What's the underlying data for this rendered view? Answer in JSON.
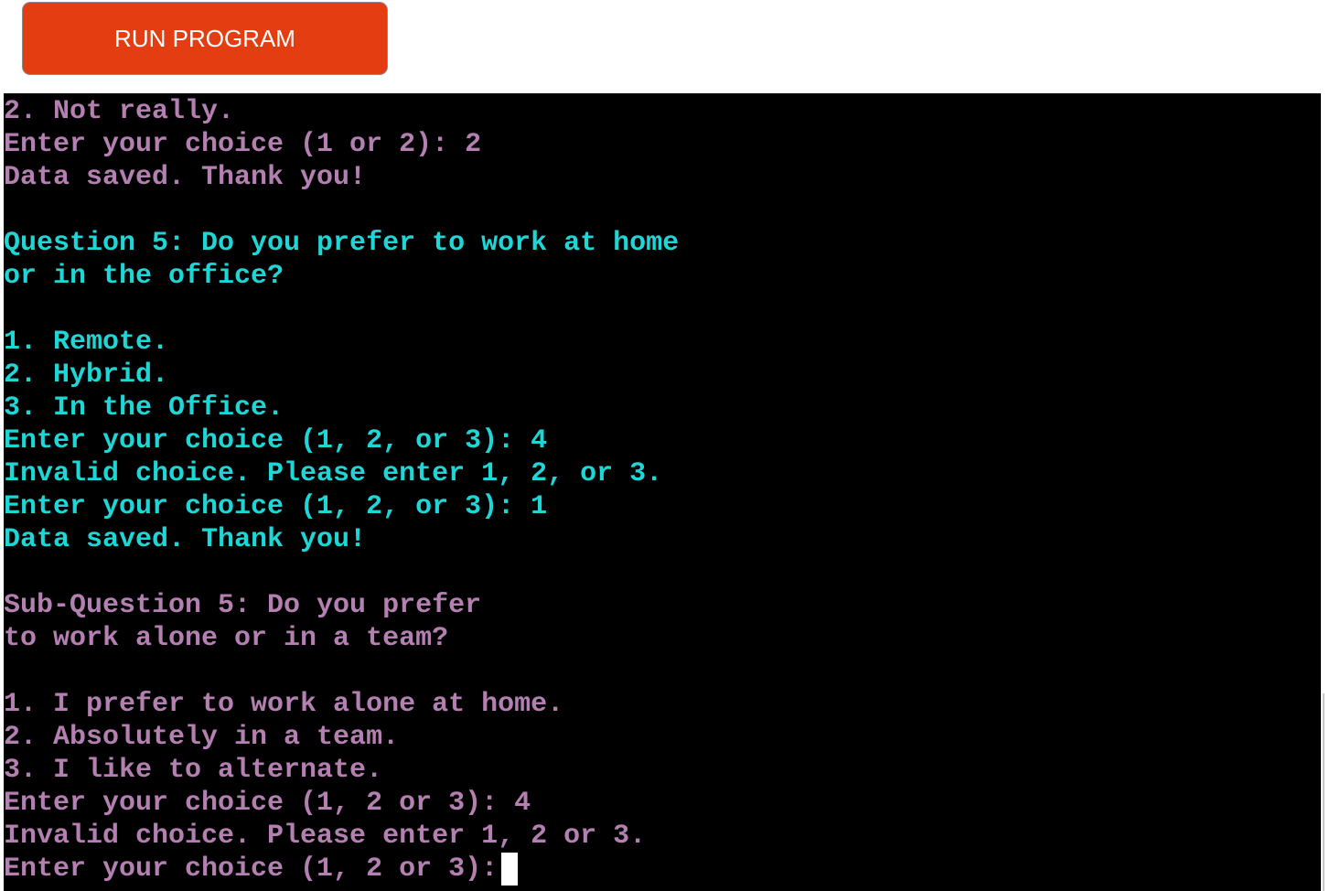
{
  "run_button": {
    "label": "RUN PROGRAM"
  },
  "colors": {
    "button_bg": "#e43d12",
    "terminal_bg": "#000000",
    "purple_text": "#b47fb1",
    "cyan_text": "#1fd6d6",
    "cursor": "#ffffff"
  },
  "terminal": {
    "lines": [
      {
        "text": "2. Not really.",
        "color": "purple"
      },
      {
        "text": "Enter your choice (1 or 2): 2",
        "color": "purple"
      },
      {
        "text": "Data saved. Thank you!",
        "color": "purple"
      },
      {
        "text": "",
        "color": "purple"
      },
      {
        "text": "Question 5: Do you prefer to work at home",
        "color": "cyan"
      },
      {
        "text": "or in the office?",
        "color": "cyan"
      },
      {
        "text": "",
        "color": "cyan"
      },
      {
        "text": "1. Remote.",
        "color": "cyan"
      },
      {
        "text": "2. Hybrid.",
        "color": "cyan"
      },
      {
        "text": "3. In the Office.",
        "color": "cyan"
      },
      {
        "text": "Enter your choice (1, 2, or 3): 4",
        "color": "cyan"
      },
      {
        "text": "Invalid choice. Please enter 1, 2, or 3.",
        "color": "cyan"
      },
      {
        "text": "Enter your choice (1, 2, or 3): 1",
        "color": "cyan"
      },
      {
        "text": "Data saved. Thank you!",
        "color": "cyan"
      },
      {
        "text": "",
        "color": "purple"
      },
      {
        "text": "Sub-Question 5: Do you prefer",
        "color": "purple"
      },
      {
        "text": "to work alone or in a team?",
        "color": "purple"
      },
      {
        "text": "",
        "color": "purple"
      },
      {
        "text": "1. I prefer to work alone at home.",
        "color": "purple"
      },
      {
        "text": "2. Absolutely in a team.",
        "color": "purple"
      },
      {
        "text": "3. I like to alternate.",
        "color": "purple"
      },
      {
        "text": "Enter your choice (1, 2 or 3): 4",
        "color": "purple"
      },
      {
        "text": "Invalid choice. Please enter 1, 2 or 3.",
        "color": "purple"
      }
    ],
    "prompt": {
      "text": "Enter your choice (1, 2 or 3):",
      "color": "purple"
    }
  }
}
